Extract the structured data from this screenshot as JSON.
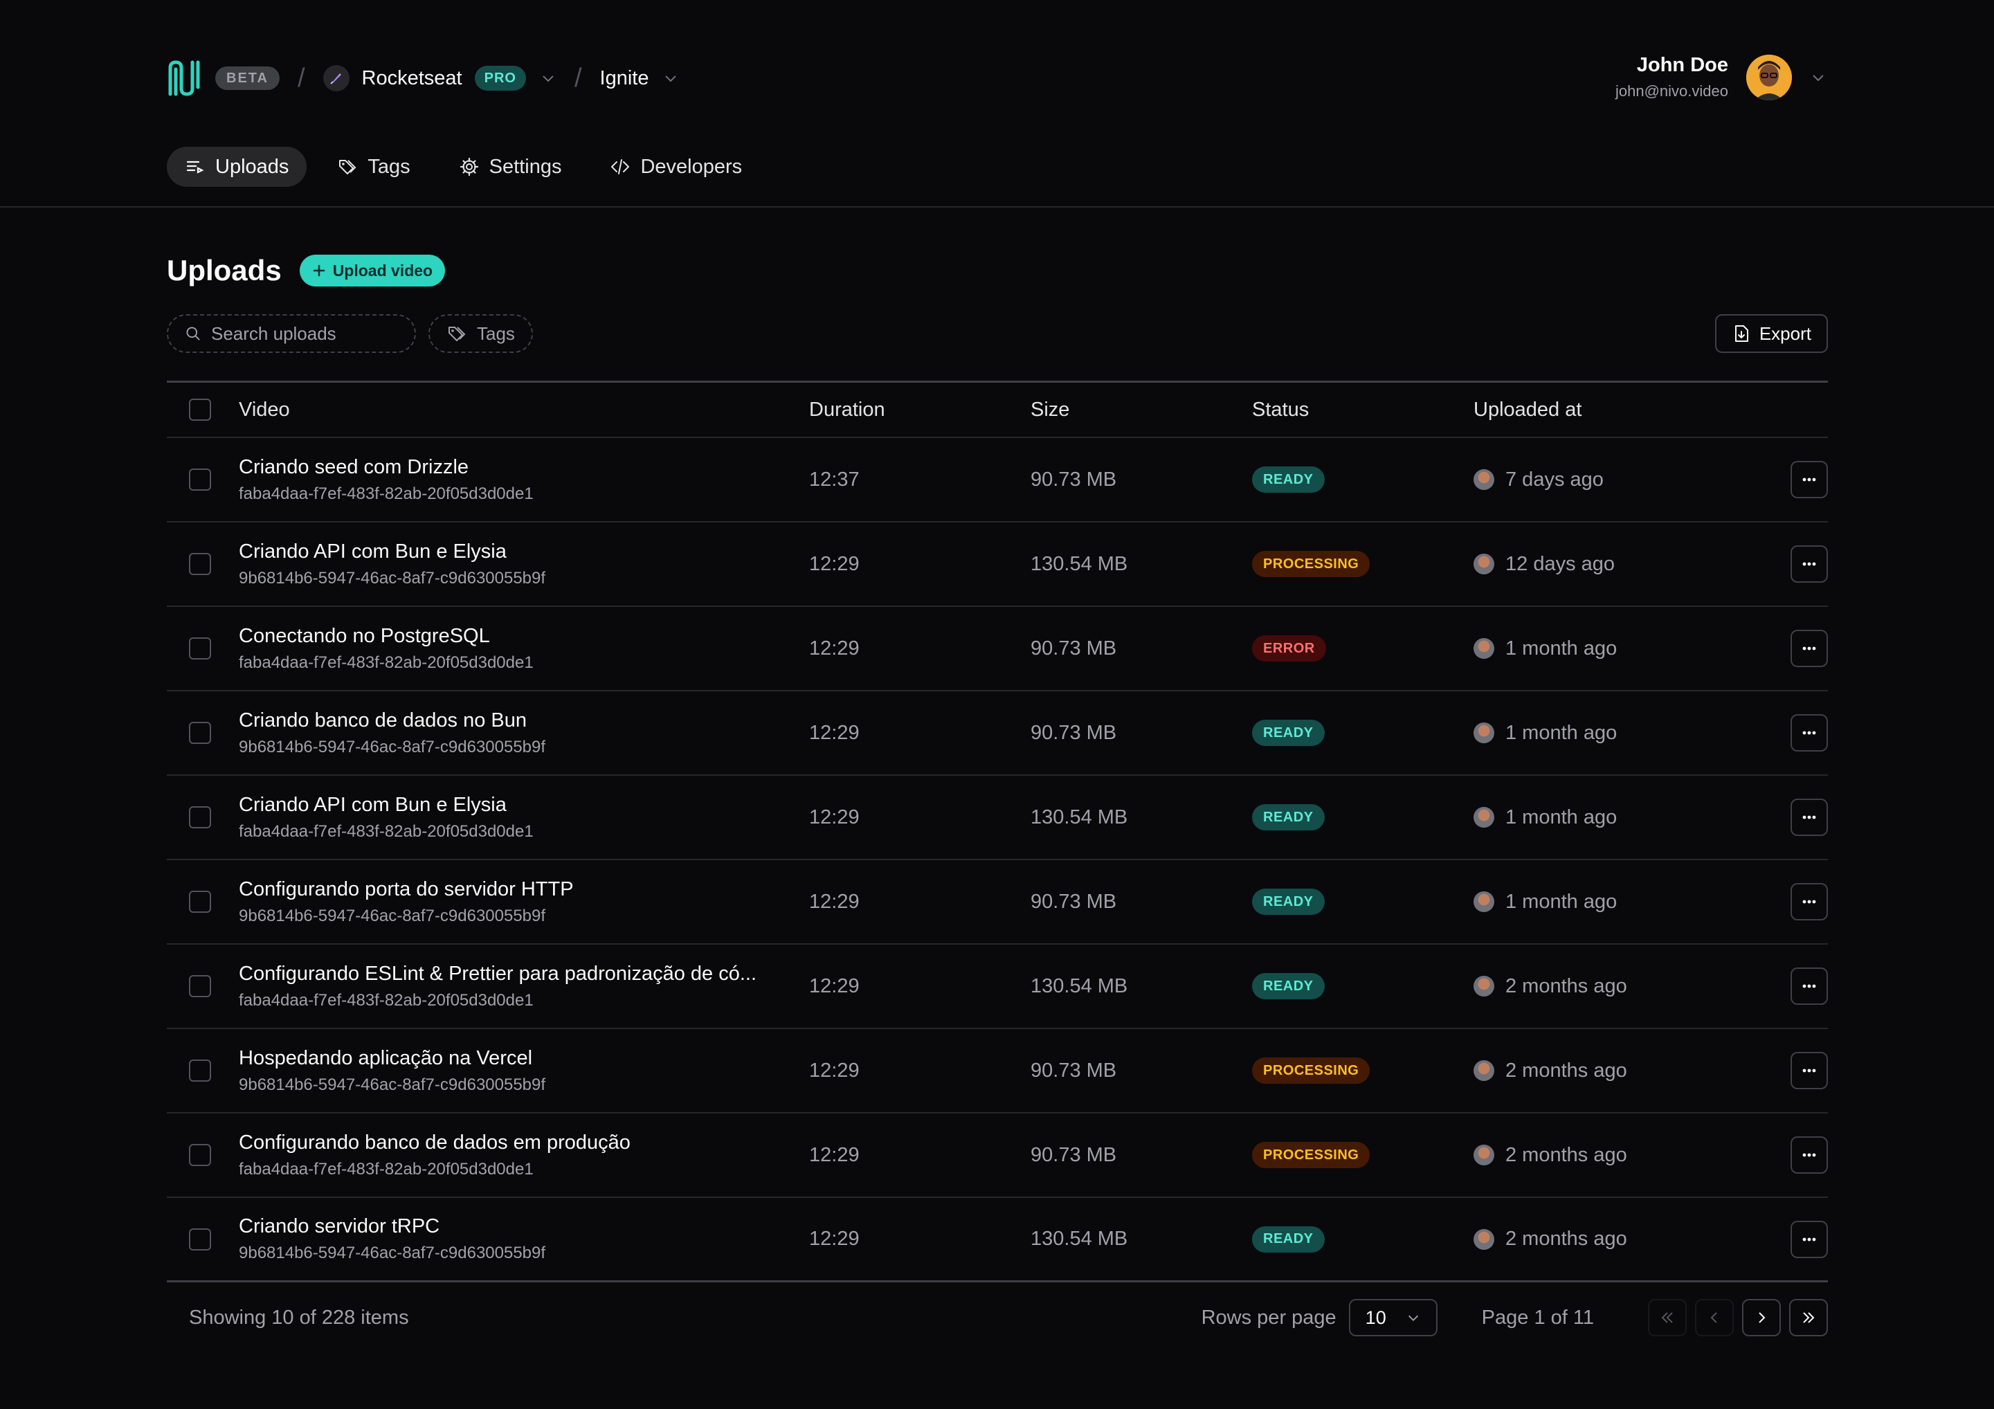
{
  "header": {
    "beta": "BETA",
    "org": {
      "name": "Rocketseat",
      "plan": "PRO"
    },
    "project": "Ignite",
    "user": {
      "name": "John Doe",
      "email": "john@nivo.video"
    }
  },
  "nav": [
    {
      "label": "Uploads",
      "icon": "uploads-icon",
      "active": true
    },
    {
      "label": "Tags",
      "icon": "tag-icon"
    },
    {
      "label": "Settings",
      "icon": "gear-icon"
    },
    {
      "label": "Developers",
      "icon": "code-icon"
    }
  ],
  "page": {
    "title": "Uploads",
    "upload_label": "Upload video",
    "search_placeholder": "Search uploads",
    "tags_filter": "Tags",
    "export_label": "Export"
  },
  "table": {
    "columns": [
      "Video",
      "Duration",
      "Size",
      "Status",
      "Uploaded at"
    ],
    "rows": [
      {
        "title": "Criando seed com Drizzle",
        "id": "faba4daa-f7ef-483f-82ab-20f05d3d0de1",
        "duration": "12:37",
        "size": "90.73 MB",
        "status": "READY",
        "uploaded": "7 days ago"
      },
      {
        "title": "Criando API com Bun e Elysia",
        "id": "9b6814b6-5947-46ac-8af7-c9d630055b9f",
        "duration": "12:29",
        "size": "130.54 MB",
        "status": "PROCESSING",
        "uploaded": "12 days ago"
      },
      {
        "title": "Conectando no PostgreSQL",
        "id": "faba4daa-f7ef-483f-82ab-20f05d3d0de1",
        "duration": "12:29",
        "size": "90.73 MB",
        "status": "ERROR",
        "uploaded": "1 month ago"
      },
      {
        "title": "Criando banco de dados no Bun",
        "id": "9b6814b6-5947-46ac-8af7-c9d630055b9f",
        "duration": "12:29",
        "size": "90.73 MB",
        "status": "READY",
        "uploaded": "1 month ago"
      },
      {
        "title": "Criando API com Bun e Elysia",
        "id": "faba4daa-f7ef-483f-82ab-20f05d3d0de1",
        "duration": "12:29",
        "size": "130.54 MB",
        "status": "READY",
        "uploaded": "1 month ago"
      },
      {
        "title": "Configurando porta do servidor HTTP",
        "id": "9b6814b6-5947-46ac-8af7-c9d630055b9f",
        "duration": "12:29",
        "size": "90.73 MB",
        "status": "READY",
        "uploaded": "1 month ago"
      },
      {
        "title": "Configurando ESLint & Prettier para padronização de có...",
        "id": "faba4daa-f7ef-483f-82ab-20f05d3d0de1",
        "duration": "12:29",
        "size": "130.54 MB",
        "status": "READY",
        "uploaded": "2 months ago"
      },
      {
        "title": "Hospedando aplicação na Vercel",
        "id": "9b6814b6-5947-46ac-8af7-c9d630055b9f",
        "duration": "12:29",
        "size": "90.73 MB",
        "status": "PROCESSING",
        "uploaded": "2 months ago"
      },
      {
        "title": "Configurando banco de dados em produção",
        "id": "faba4daa-f7ef-483f-82ab-20f05d3d0de1",
        "duration": "12:29",
        "size": "90.73 MB",
        "status": "PROCESSING",
        "uploaded": "2 months ago"
      },
      {
        "title": "Criando servidor tRPC",
        "id": "9b6814b6-5947-46ac-8af7-c9d630055b9f",
        "duration": "12:29",
        "size": "130.54 MB",
        "status": "READY",
        "uploaded": "2 months ago"
      }
    ]
  },
  "footer": {
    "showing": "Showing 10 of 228 items",
    "rows_per_page_label": "Rows per page",
    "rows_per_page": "10",
    "page": "Page 1 of 11"
  },
  "colors": {
    "accent": "#2dd4bf",
    "background": "#09090b",
    "ready": "#5eead4",
    "processing": "#fbbf24",
    "error": "#f87171"
  }
}
